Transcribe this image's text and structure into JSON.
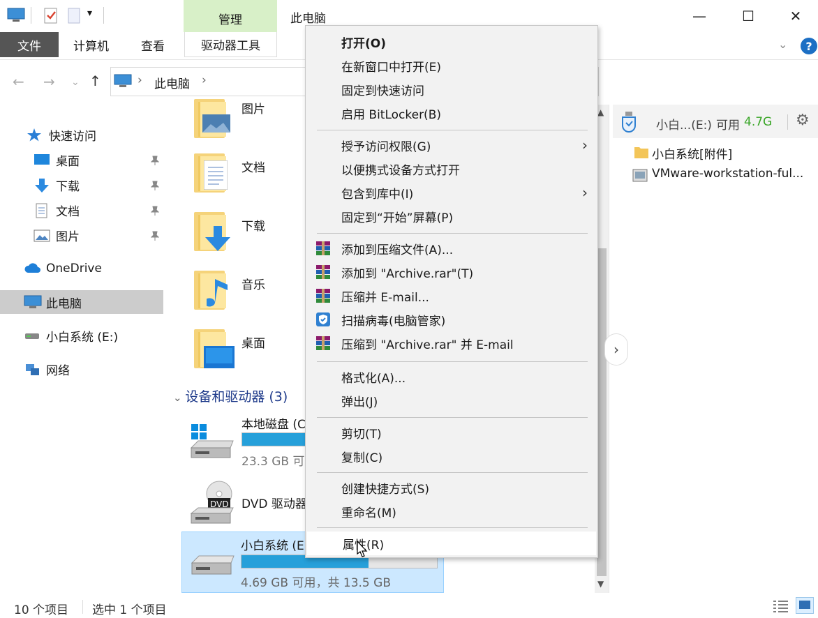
{
  "titlebar": {
    "manage_tab": "管理",
    "window_title": "此电脑",
    "minimize": "—",
    "maximize": "☐",
    "close": "✕"
  },
  "ribbon": {
    "file": "文件",
    "computer": "计算机",
    "view": "查看",
    "drive_tools": "驱动器工具"
  },
  "address": {
    "crumb": "此电脑",
    "sep": "›"
  },
  "sidebar": {
    "items": [
      {
        "label": "快速访问",
        "icon": "star-icon"
      },
      {
        "label": "桌面",
        "icon": "desktop-icon"
      },
      {
        "label": "下载",
        "icon": "download-icon"
      },
      {
        "label": "文档",
        "icon": "document-icon"
      },
      {
        "label": "图片",
        "icon": "picture-icon"
      },
      {
        "label": "OneDrive",
        "icon": "cloud-icon"
      },
      {
        "label": "此电脑",
        "icon": "computer-icon"
      },
      {
        "label": "小白系统 (E:)",
        "icon": "drive-icon"
      },
      {
        "label": "网络",
        "icon": "network-icon"
      }
    ]
  },
  "content": {
    "folders": [
      {
        "label": "图片"
      },
      {
        "label": "文档"
      },
      {
        "label": "下载"
      },
      {
        "label": "音乐"
      },
      {
        "label": "桌面"
      }
    ],
    "section_header": "设备和驱动器 (3)",
    "drives": [
      {
        "name": "本地磁盘 (C:)",
        "detail": "23.3 GB 可用，共 40.0 GB",
        "used_fraction": 0.42
      },
      {
        "name": "DVD 驱动器 (D:)",
        "detail": "",
        "used_fraction": null
      },
      {
        "name": "小白系统 (E:)",
        "detail": "4.69 GB 可用，共 13.5 GB",
        "used_fraction": 0.65
      }
    ]
  },
  "context_menu": {
    "items": [
      {
        "label": "打开(O)",
        "bold": true
      },
      {
        "label": "在新窗口中打开(E)"
      },
      {
        "label": "固定到快速访问"
      },
      {
        "label": "启用 BitLocker(B)"
      },
      {
        "label": "授予访问权限(G)",
        "submenu": true
      },
      {
        "label": "以便携式设备方式打开"
      },
      {
        "label": "包含到库中(I)",
        "submenu": true
      },
      {
        "label": "固定到“开始”屏幕(P)"
      },
      {
        "label": "添加到压缩文件(A)...",
        "icon": "winrar-icon"
      },
      {
        "label": "添加到 \"Archive.rar\"(T)",
        "icon": "winrar-icon"
      },
      {
        "label": "压缩并 E-mail...",
        "icon": "winrar-icon"
      },
      {
        "label": "扫描病毒(电脑管家)",
        "icon": "shield-icon"
      },
      {
        "label": "压缩到 \"Archive.rar\" 并 E-mail",
        "icon": "winrar-icon"
      },
      {
        "label": "格式化(A)..."
      },
      {
        "label": "弹出(J)"
      },
      {
        "label": "剪切(T)"
      },
      {
        "label": "复制(C)"
      },
      {
        "label": "创建快捷方式(S)"
      },
      {
        "label": "重命名(M)"
      },
      {
        "label": "属性(R)",
        "hover": true
      }
    ]
  },
  "right_panel": {
    "drive_label": "小白...(E:)",
    "available_label": "可用",
    "available_value": "4.7G",
    "files": [
      {
        "name": "小白系统[附件]",
        "icon": "folder-icon"
      },
      {
        "name": "VMware-workstation-ful...",
        "icon": "installer-icon"
      }
    ]
  },
  "status": {
    "count": "10 个项目",
    "selected": "选中 1 个项目"
  },
  "colors": {
    "accent": "#26a0da",
    "manage_tab": "#d8f0c8",
    "available_green": "#3aa628"
  }
}
